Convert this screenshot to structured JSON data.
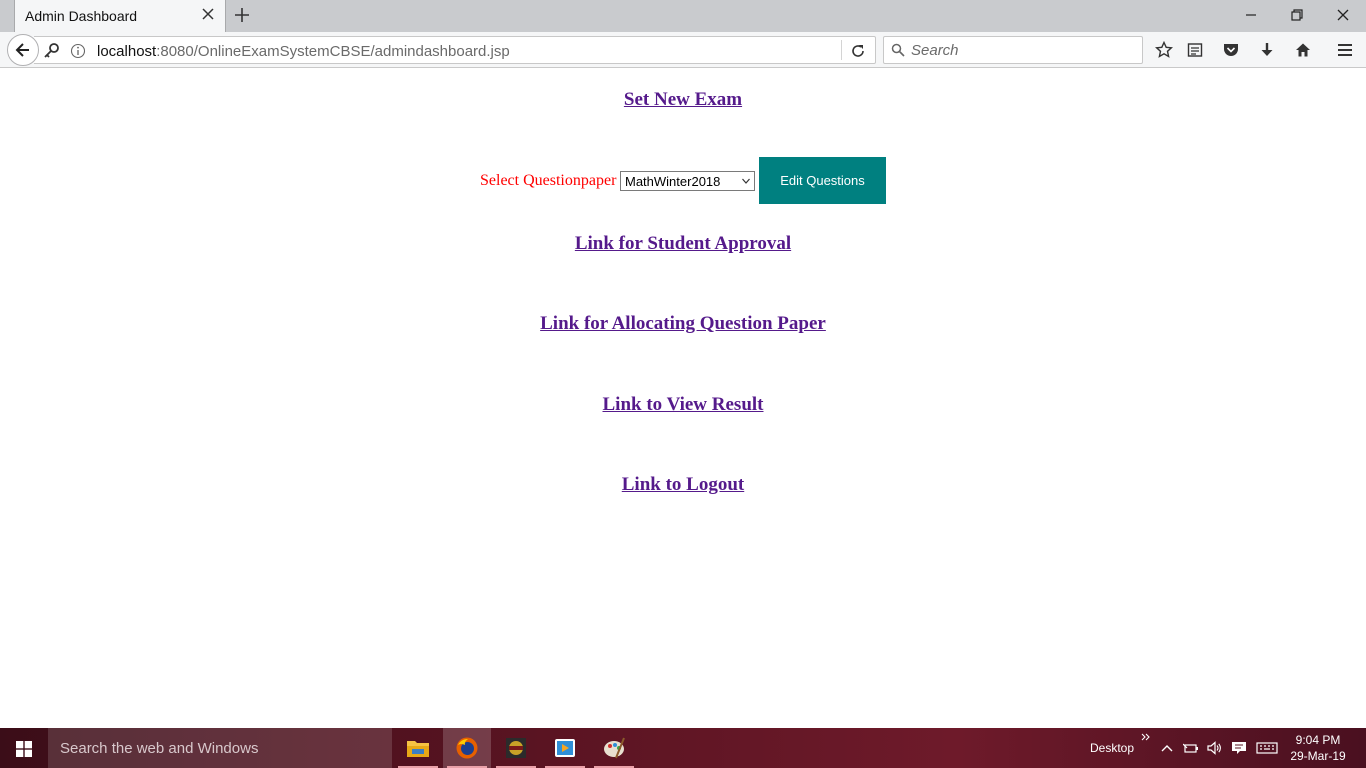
{
  "browser": {
    "tab_title": "Admin Dashboard",
    "url_host": "localhost",
    "url_rest": ":8080/OnlineExamSystemCBSE/admindashboard.jsp",
    "search_placeholder": "Search"
  },
  "page": {
    "set_new_exam": "Set New Exam",
    "select_label": "Select Questionpaper",
    "selected_paper": "MathWinter2018",
    "edit_button": "Edit Questions",
    "student_approval": "Link for Student Approval",
    "allocate_paper": "Link for Allocating Question Paper",
    "view_result": "Link to View Result",
    "logout": "Link to Logout"
  },
  "taskbar": {
    "search_placeholder": "Search the web and Windows",
    "desktop_label": "Desktop",
    "time": "9:04 PM",
    "date": "29-Mar-19"
  },
  "colors": {
    "link": "#551a8b",
    "label": "#ff0000",
    "button": "#008080"
  }
}
